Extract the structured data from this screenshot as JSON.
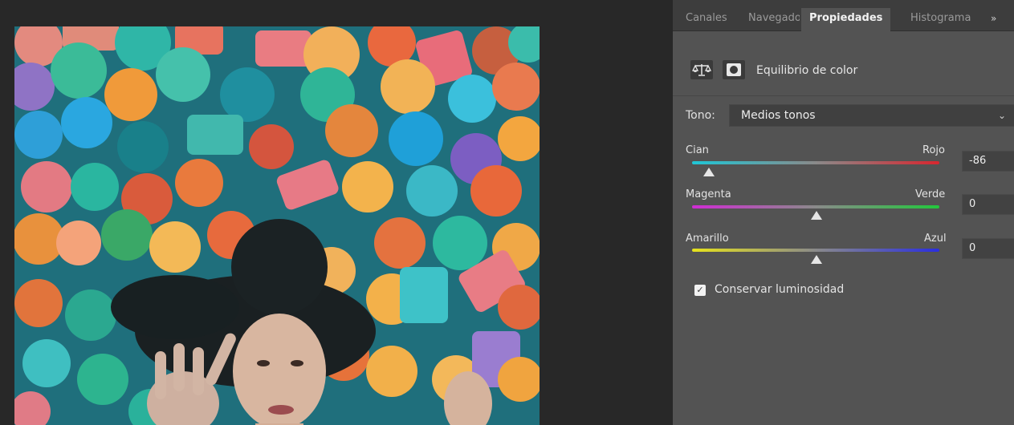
{
  "tabs": [
    {
      "label": "Canales",
      "active": false
    },
    {
      "label": "Navegador",
      "active": false
    },
    {
      "label": "Propiedades",
      "active": true
    },
    {
      "label": "Histograma",
      "active": false
    }
  ],
  "tabs_more_label": "»",
  "properties": {
    "title": "Equilibrio de color",
    "icons": [
      "balance-scale-icon",
      "layer-mask-icon"
    ]
  },
  "tone": {
    "label": "Tono:",
    "selected": "Medios tonos"
  },
  "sliders": [
    {
      "left_label": "Cian",
      "right_label": "Rojo",
      "value": "-86",
      "numeric": -86,
      "colors": [
        "#1fc6d6",
        "#d8262f"
      ]
    },
    {
      "left_label": "Magenta",
      "right_label": "Verde",
      "value": "0",
      "numeric": 0,
      "colors": [
        "#d02cd4",
        "#22c73c"
      ]
    },
    {
      "left_label": "Amarillo",
      "right_label": "Azul",
      "value": "0",
      "numeric": 0,
      "colors": [
        "#e6e21c",
        "#2a2ee0"
      ]
    }
  ],
  "preserve_luminosity": {
    "label": "Conservar luminosidad",
    "checked": true
  }
}
